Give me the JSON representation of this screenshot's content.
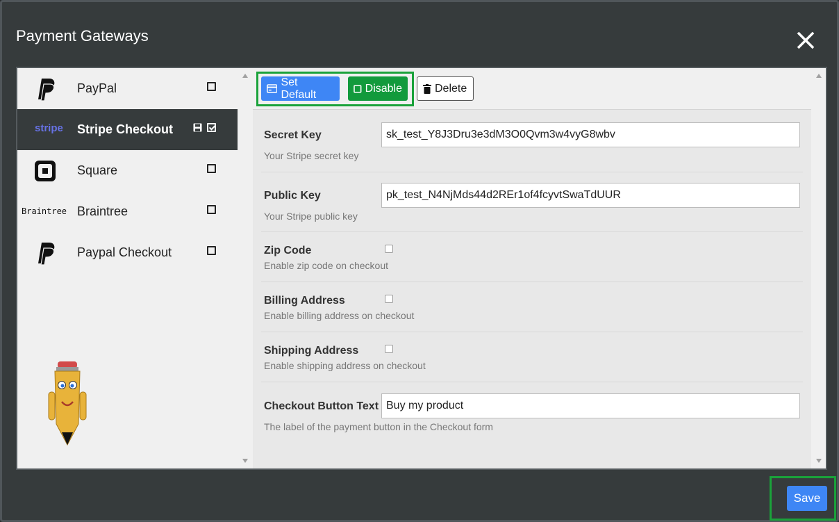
{
  "dialog": {
    "title": "Payment Gateways",
    "close_icon": "close-icon"
  },
  "sidebar": {
    "items": [
      {
        "label": "PayPal",
        "logo": "paypal-logo",
        "checked": false,
        "active": false
      },
      {
        "label": "Stripe Checkout",
        "logo": "stripe-logo",
        "logo_text": "stripe",
        "checked": true,
        "active": true
      },
      {
        "label": "Square",
        "logo": "square-logo",
        "checked": false,
        "active": false
      },
      {
        "label": "Braintree",
        "logo": "braintree-logo",
        "logo_text": "Braintree",
        "checked": false,
        "active": false
      },
      {
        "label": "Paypal Checkout",
        "logo": "paypal-logo",
        "checked": false,
        "active": false
      }
    ]
  },
  "toolbar": {
    "set_default_label": "Set Default",
    "disable_label": "Disable",
    "delete_label": "Delete"
  },
  "form": {
    "secret_key": {
      "label": "Secret Key",
      "value": "sk_test_Y8J3Dru3e3dM3O0Qvm3w4vyG8wbv",
      "help": "Your Stripe secret key"
    },
    "public_key": {
      "label": "Public Key",
      "value": "pk_test_N4NjMds44d2REr1of4fcyvtSwaTdUUR",
      "help": "Your Stripe public key"
    },
    "zip_code": {
      "label": "Zip Code",
      "help": "Enable zip code on checkout",
      "checked": false
    },
    "billing_address": {
      "label": "Billing Address",
      "help": "Enable billing address on checkout",
      "checked": false
    },
    "shipping_address": {
      "label": "Shipping Address",
      "help": "Enable shipping address on checkout",
      "checked": false
    },
    "checkout_button_text": {
      "label": "Checkout Button Text",
      "value": "Buy my product",
      "help": "The label of the payment button in the Checkout form"
    }
  },
  "footer": {
    "save_label": "Save"
  },
  "colors": {
    "primary": "#3e86f5",
    "success": "#129a3c",
    "highlight": "#1aa23a",
    "dark": "#363b3c"
  }
}
